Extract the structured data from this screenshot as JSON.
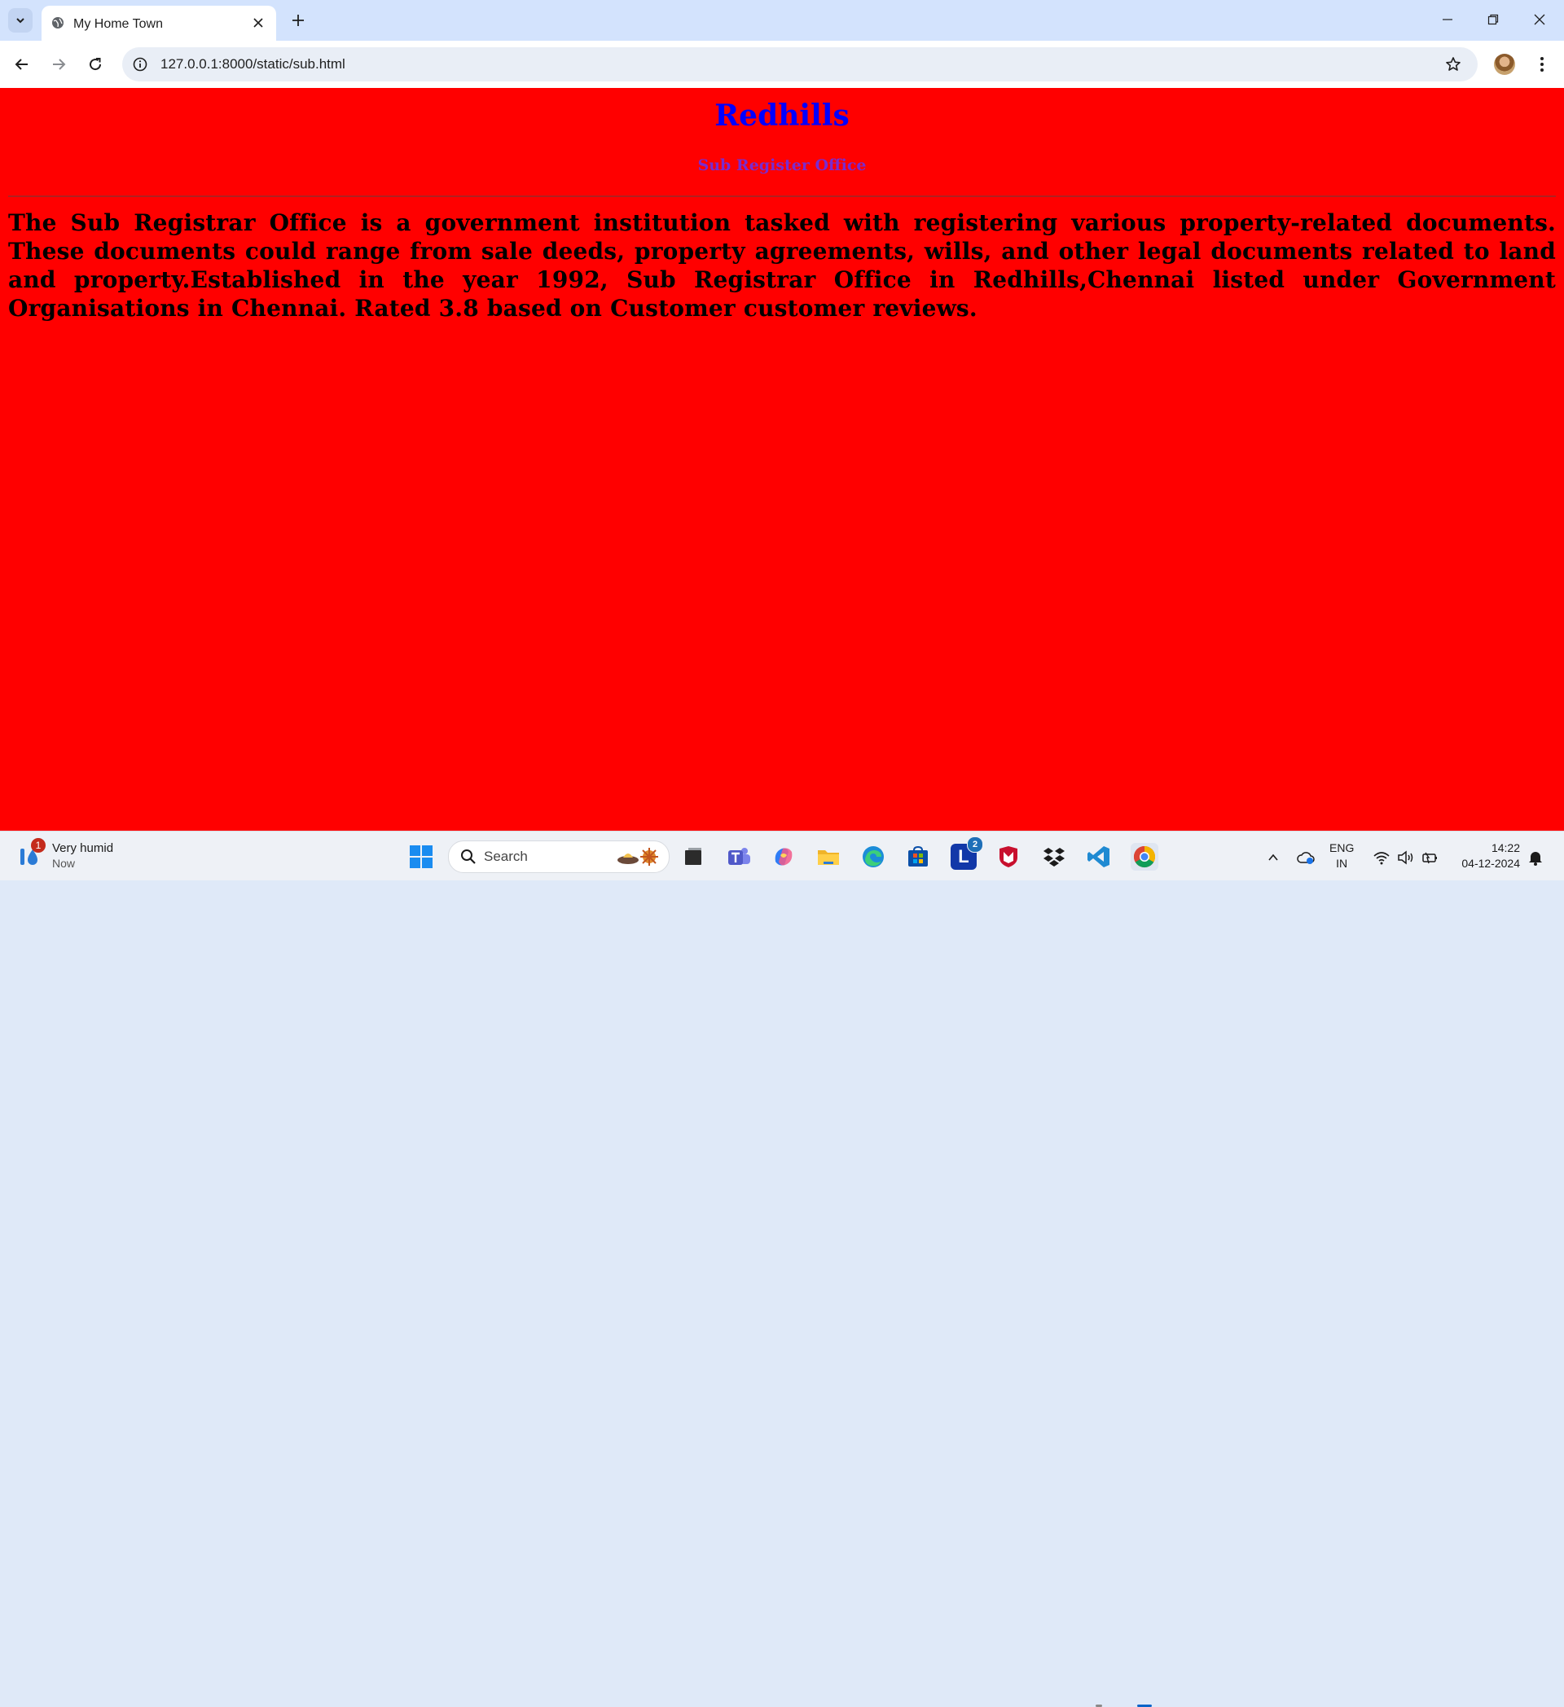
{
  "browser": {
    "tab_title": "My Home Town",
    "url": "127.0.0.1:8000/static/sub.html"
  },
  "page": {
    "title": "Redhills",
    "subtitle": "Sub Register Office",
    "background_color": "#ff0000",
    "title_color": "#0000ff",
    "subtitle_color": "#7a2bd0",
    "body": "The Sub Registrar Office is a government institution tasked with registering various property-related documents. These documents could range from sale deeds, property agreements, wills, and other legal documents related to land and property.Established in the year 1992, Sub Registrar Office in Redhills,Chennai listed under Government Organisations in Chennai. Rated 3.8 based on Customer customer reviews."
  },
  "taskbar": {
    "weather": {
      "condition": "Very humid",
      "time": "Now",
      "badge": "1"
    },
    "search_label": "Search",
    "pinned_apps": [
      "file-explorer",
      "teams",
      "copilot",
      "folder",
      "edge",
      "microsoft-store",
      "l-app",
      "mcafee",
      "dropbox",
      "vscode",
      "chrome"
    ],
    "l_app_badge": "2",
    "language": {
      "line1": "ENG",
      "line2": "IN"
    },
    "clock": {
      "time": "14:22",
      "date": "04-12-2024"
    }
  }
}
